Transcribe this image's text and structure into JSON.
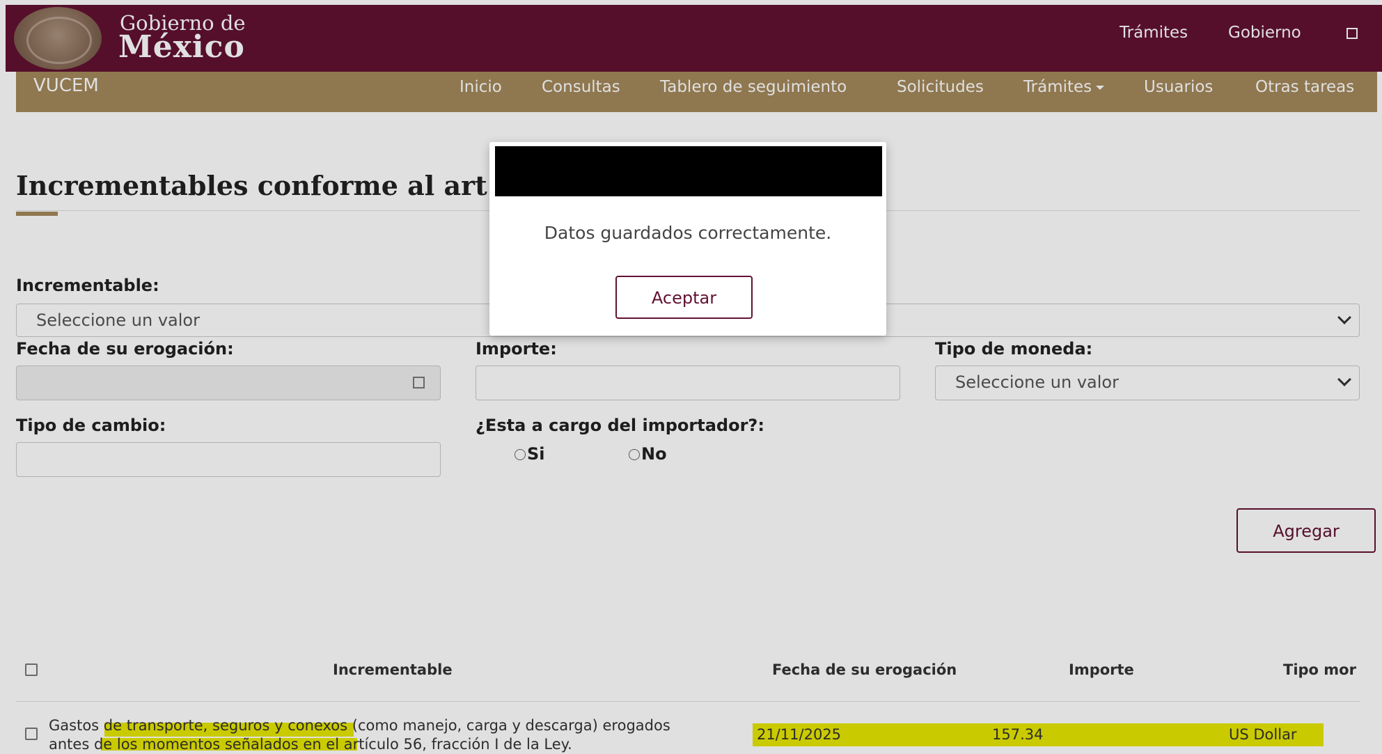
{
  "header": {
    "brand_line1": "Gobierno de",
    "brand_line2": "México",
    "links": [
      "Trámites",
      "Gobierno"
    ]
  },
  "nav": {
    "brand": "VUCEM",
    "items": [
      "Inicio",
      "Consultas",
      "Tablero de seguimiento",
      "Solicitudes",
      "Trámites",
      "Usuarios",
      "Otras tareas"
    ]
  },
  "form": {
    "title": "Incrementables conforme al art",
    "incrementable_label": "Incrementable:",
    "incrementable_value": "Seleccione un valor",
    "fecha_label": "Fecha de su erogación:",
    "importe_label": "Importe:",
    "moneda_label": "Tipo de moneda:",
    "moneda_value": "Seleccione un valor",
    "cambio_label": "Tipo de cambio:",
    "cargo_label": "¿Esta a cargo del importador?:",
    "radio_si": "Si",
    "radio_no": "No",
    "add_button": "Agregar"
  },
  "table": {
    "headers": [
      "Incrementable",
      "Fecha de su erogación",
      "Importe",
      "Tipo mor"
    ],
    "rows": [
      {
        "incrementable_line1": "Gastos de transporte, seguros y conexos (como manejo, carga y descarga) erogados",
        "incrementable_line2": "antes de los momentos señalados en el artículo 56, fracción I de la Ley.",
        "fecha": "21/11/2025",
        "importe": "157.34",
        "moneda": "US Dollar"
      }
    ]
  },
  "modal": {
    "message": "Datos guardados correctamente.",
    "accept_button": "Aceptar"
  },
  "colors": {
    "header_bg": "#611232",
    "nav_bg": "#a3885a",
    "highlight": "#e6e600"
  }
}
